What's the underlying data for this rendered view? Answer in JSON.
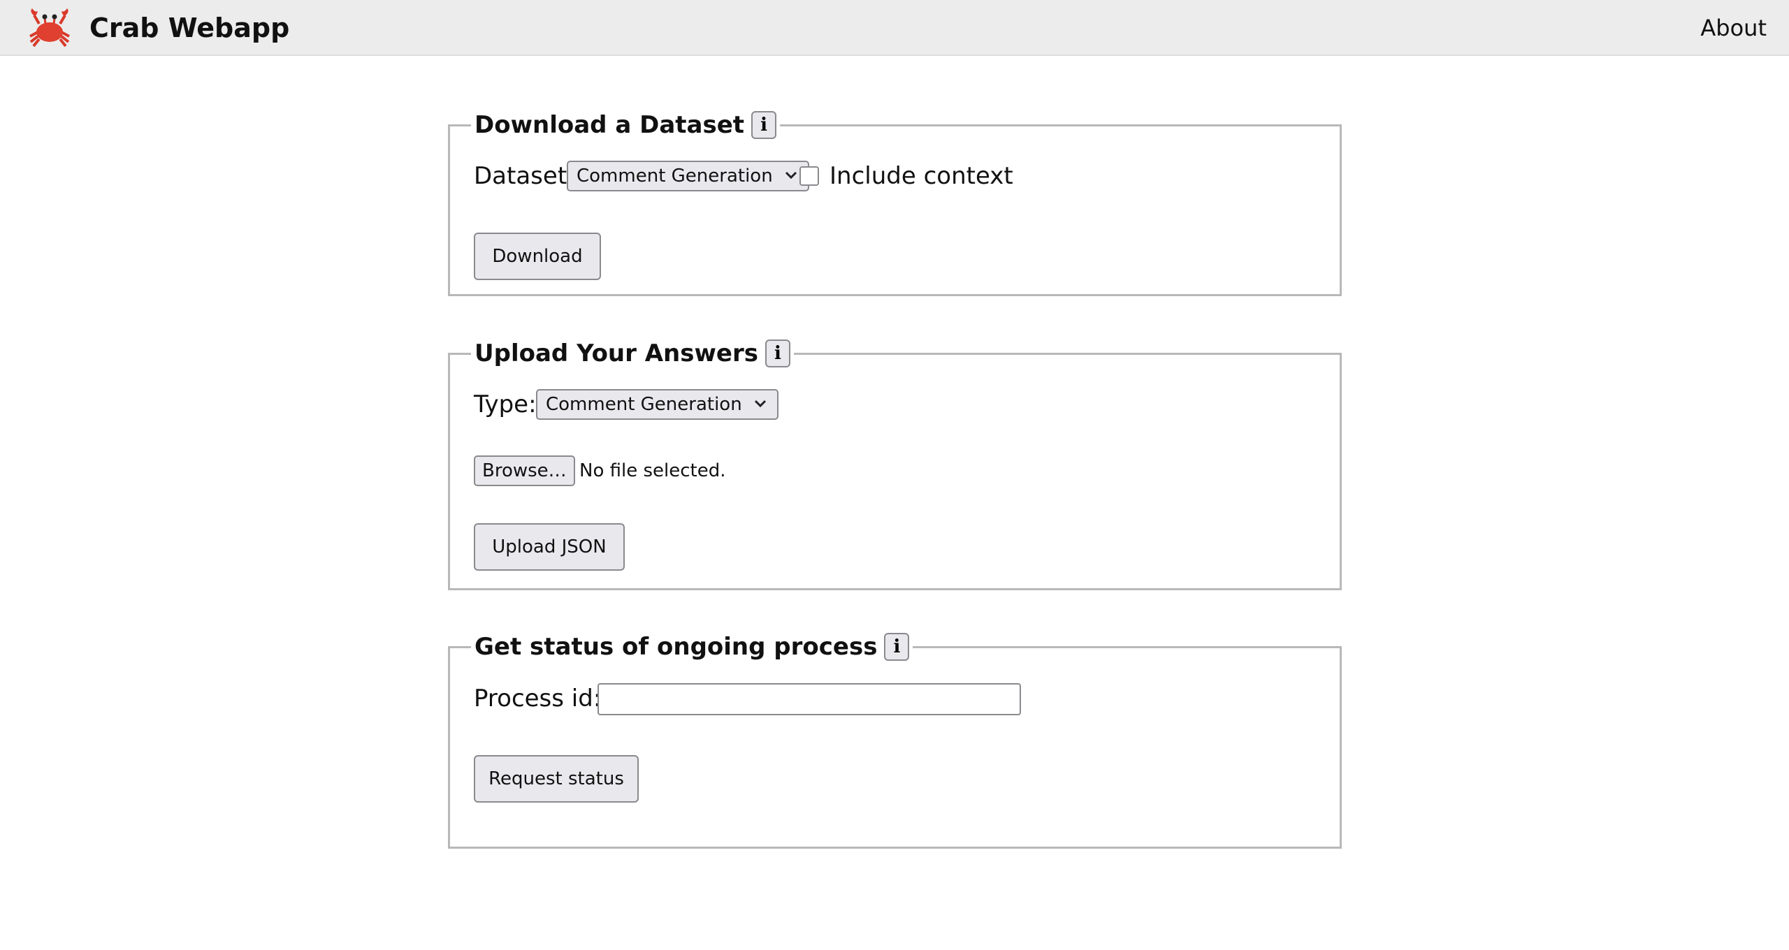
{
  "header": {
    "logo_icon": "crab-icon",
    "title": "Crab Webapp",
    "nav": {
      "about": "About"
    }
  },
  "download_panel": {
    "legend": "Download a Dataset",
    "info_icon": "info-icon",
    "dataset_label": "Dataset:",
    "dataset_selected": "Comment Generation",
    "include_context_label": "Include context",
    "include_context_checked": false,
    "download_button": "Download"
  },
  "upload_panel": {
    "legend": "Upload Your Answers",
    "info_icon": "info-icon",
    "type_label": "Type:",
    "type_selected": "Comment Generation",
    "browse_button": "Browse…",
    "file_status": "No file selected.",
    "upload_button": "Upload JSON"
  },
  "status_panel": {
    "legend": "Get status of ongoing process",
    "info_icon": "info-icon",
    "process_id_label": "Process id:",
    "process_id_value": "",
    "request_button": "Request status"
  },
  "colors": {
    "header_bg": "#ececec",
    "button_bg": "#e9e9ed",
    "border": "#8a8a8e",
    "fieldset_border": "#b8b8b8"
  }
}
